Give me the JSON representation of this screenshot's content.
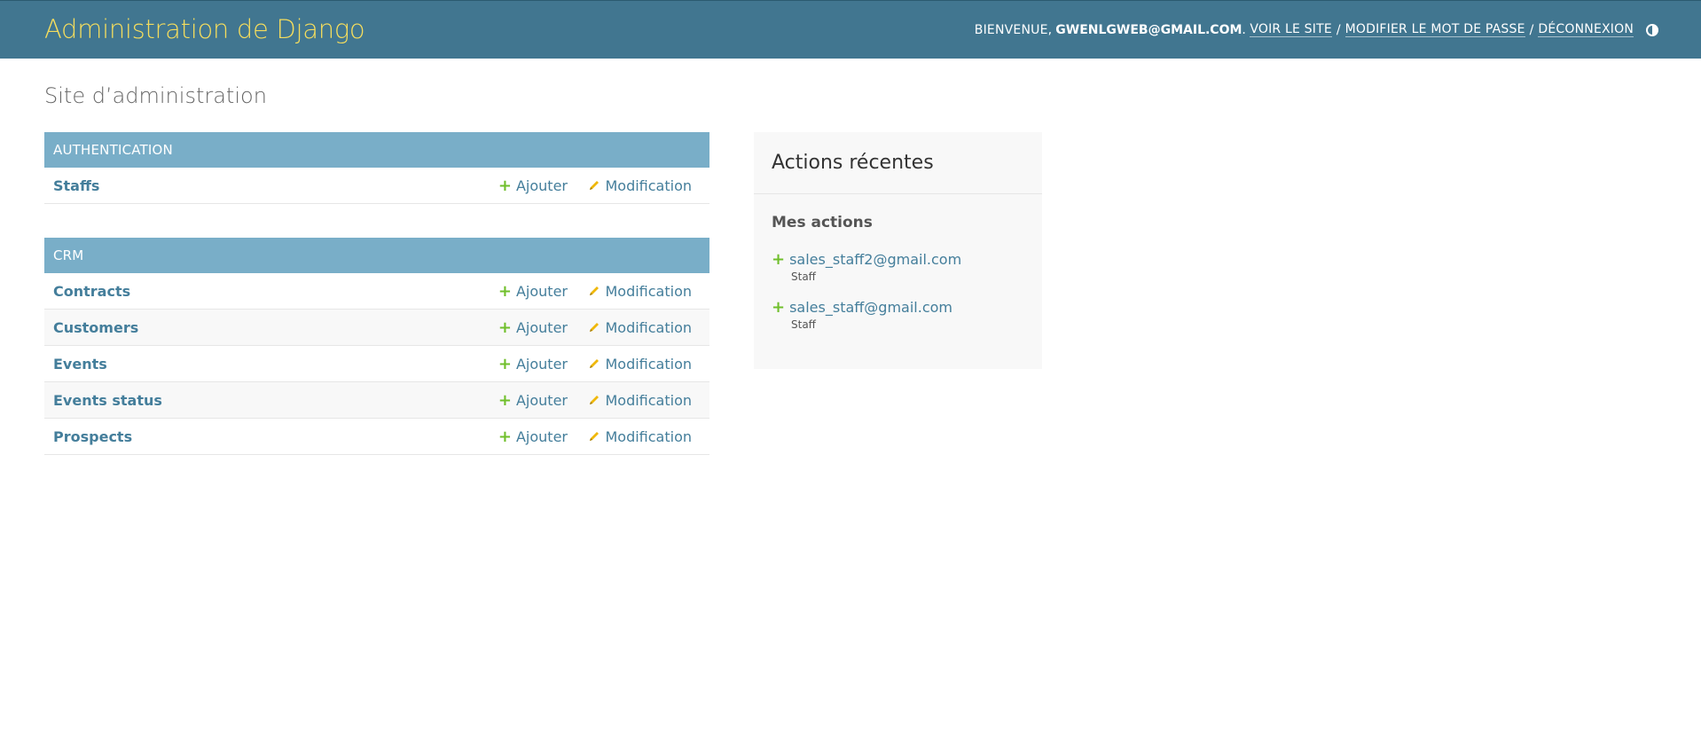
{
  "header": {
    "brand": "Administration de Django",
    "welcome": "BIENVENUE,",
    "user": "GWENLGWEB@GMAIL.COM",
    "view_site": "VOIR LE SITE",
    "change_password": "MODIFIER LE MOT DE PASSE",
    "logout": "DÉCONNEXION",
    "separator": "/",
    "theme_icon": "theme-toggle-icon"
  },
  "page": {
    "title": "Site d’administration"
  },
  "apps": [
    {
      "name": "AUTHENTICATION",
      "models": [
        {
          "name": "Staffs",
          "add": "Ajouter",
          "change": "Modification"
        }
      ]
    },
    {
      "name": "CRM",
      "models": [
        {
          "name": "Contracts",
          "add": "Ajouter",
          "change": "Modification"
        },
        {
          "name": "Customers",
          "add": "Ajouter",
          "change": "Modification"
        },
        {
          "name": "Events",
          "add": "Ajouter",
          "change": "Modification"
        },
        {
          "name": "Events status",
          "add": "Ajouter",
          "change": "Modification"
        },
        {
          "name": "Prospects",
          "add": "Ajouter",
          "change": "Modification"
        }
      ]
    }
  ],
  "recent_actions": {
    "title": "Actions récentes",
    "subtitle": "Mes actions",
    "items": [
      {
        "label": "sales_staff2@gmail.com",
        "type": "Staff",
        "icon": "add-icon"
      },
      {
        "label": "sales_staff@gmail.com",
        "type": "Staff",
        "icon": "add-icon"
      }
    ]
  },
  "colors": {
    "header_bg": "#417690",
    "brand": "#f5dd5d",
    "caption_bg": "#79aec8",
    "link": "#447e9b",
    "add_icon": "#70bf2b",
    "change_icon": "#efb80b"
  }
}
